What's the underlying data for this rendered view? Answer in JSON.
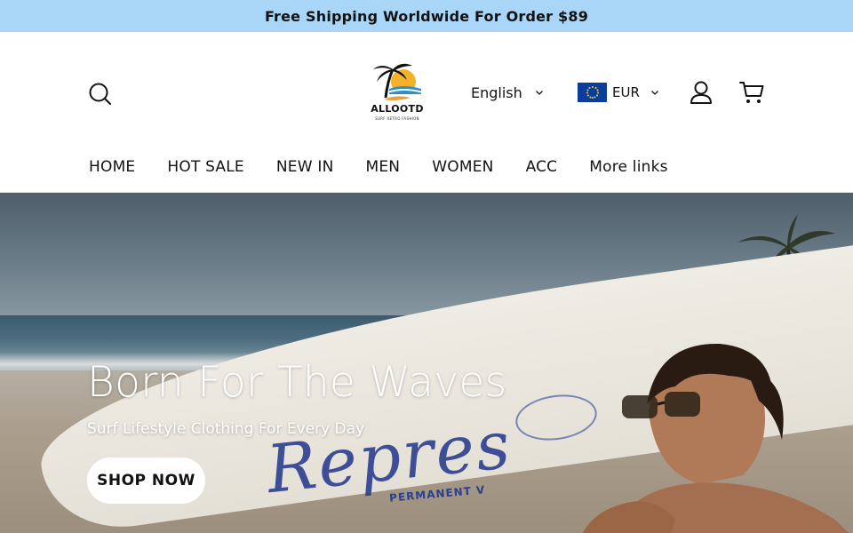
{
  "announcement": {
    "text": "Free Shipping Worldwide For Order $89"
  },
  "header": {
    "logo": {
      "name": "ALLOOTD",
      "tagline": "SURF RETRO FASHION"
    },
    "language": {
      "selected": "English"
    },
    "currency": {
      "selected": "EUR"
    },
    "icons": {
      "search": "search-icon",
      "account": "user-icon",
      "cart": "cart-icon",
      "language_caret": "chevron-down-icon",
      "currency_caret": "chevron-down-icon"
    }
  },
  "nav": {
    "items": [
      {
        "label": "HOME"
      },
      {
        "label": "HOT SALE"
      },
      {
        "label": "NEW IN"
      },
      {
        "label": "MEN"
      },
      {
        "label": "WOMEN"
      },
      {
        "label": "ACC"
      },
      {
        "label": "More links"
      }
    ]
  },
  "hero": {
    "title": "Born  For The Waves",
    "subtitle": "Surf Lifestyle Clothing For Every Day",
    "cta": "SHOP NOW",
    "board_text": "Repres",
    "board_subtext": "PERMANENT V"
  },
  "colors": {
    "announcement_bg": "#a9d6f7",
    "text": "#121212",
    "flag_blue": "#0a3d9c",
    "flag_stars": "#f6d31d"
  }
}
